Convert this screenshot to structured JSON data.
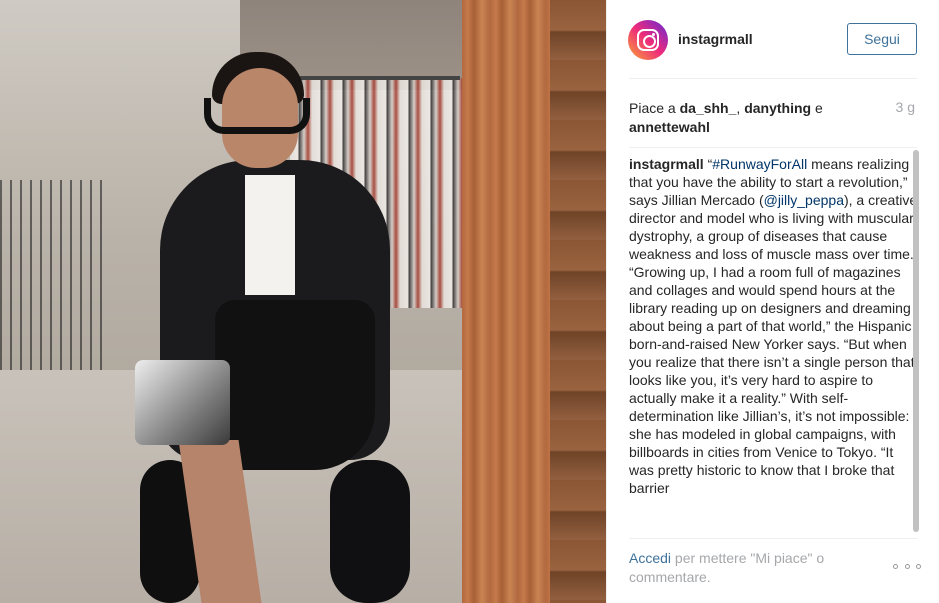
{
  "header": {
    "username": "instagrmall",
    "follow_label": "Segui"
  },
  "likes": {
    "prefix": "Piace a ",
    "users": [
      "da_shh_",
      "danything",
      "annettewahl"
    ],
    "sep1": ", ",
    "sep2": " e ",
    "time": "3 g"
  },
  "caption": {
    "user": "instagrmall",
    "quote_open": " “",
    "hashtag": "#RunwayForAll",
    "text1": " means realizing that you have the ability to start a revolution,” says Jillian Mercado (",
    "mention": "@jilly_peppa",
    "text2": "), a creative director and model who is living with muscular dystrophy, a group of diseases that cause weakness and loss of muscle mass over time. “Growing up, I had a room full of magazines and collages and would spend hours at the library reading up on designers and dreaming about being a part of that world,” the Hispanic born-and-raised New Yorker says. “But when you realize that there isn’t a single person that looks like you, it’s very hard to aspire to actually make it a reality.” With self-determination like Jillian’s, it’s not impossible: she has modeled in global campaigns, with billboards in cities from Venice to Tokyo. “It was pretty historic to know that I broke that barrier"
  },
  "footer": {
    "login_label": "Accedi",
    "rest": " per mettere \"Mi piace\" o commentare."
  },
  "icons": {
    "avatar": "instagram-camera-icon",
    "more": "ellipsis-icon"
  },
  "colors": {
    "link": "#3f729b",
    "hashtag": "#003569",
    "muted": "#a5a7aa"
  }
}
